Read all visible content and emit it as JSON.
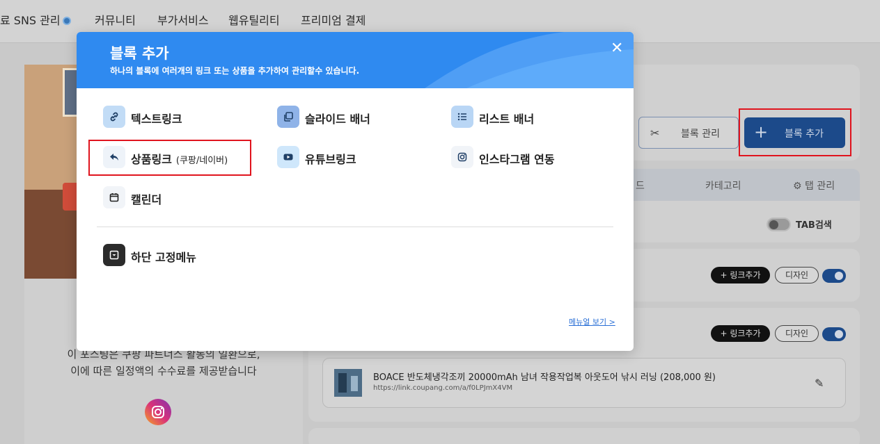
{
  "nav": {
    "items": [
      {
        "label": "료 SNS 관리",
        "badge": true
      },
      {
        "label": "커뮤니티"
      },
      {
        "label": "부가서비스"
      },
      {
        "label": "웹유틸리티"
      },
      {
        "label": "프리미엄 결제"
      }
    ]
  },
  "profile": {
    "notice_line1": "이 포스팅은 쿠팡 파트너스 활동의 일환으로,",
    "notice_line2": "이에 따른 일정액의 수수료를 제공받습니다"
  },
  "toolbar": {
    "block_manage_label": "블록 관리",
    "block_add_label": "블록 추가"
  },
  "tabs": {
    "partial_label": "드",
    "category_label": "카테고리",
    "tab_manage_label": "탭 관리",
    "tab_search_label": "TAB검색"
  },
  "blocks": [
    {
      "add_link_label": "+ 링크추가",
      "design_label": "디자인"
    },
    {
      "add_link_label": "+ 링크추가",
      "design_label": "디자인"
    }
  ],
  "product": {
    "title": "BOACE 반도체냉각조끼 20000mAh 남녀 작용작업복 아웃도어 낚시 러닝 (208,000 원)",
    "url": "https://link.coupang.com/a/f0LPJmX4VM"
  },
  "modal": {
    "title": "블록 추가",
    "subtitle": "하나의 블록에 여러개의 링크 또는 상품을 추가하여 관리할수 있습니다.",
    "items": [
      {
        "label": "텍스트링크",
        "icon": "link-icon"
      },
      {
        "label": "슬라이드 배너",
        "icon": "copy-icon"
      },
      {
        "label": "리스트 배너",
        "icon": "list-icon"
      },
      {
        "label": "상품링크",
        "sublabel": "(쿠팡/네이버)",
        "icon": "share-icon"
      },
      {
        "label": "유튜브링크",
        "icon": "youtube-icon"
      },
      {
        "label": "인스타그램 연동",
        "icon": "instagram-icon"
      },
      {
        "label": "캘린더",
        "icon": "calendar-icon"
      },
      {
        "label": "하단 고정메뉴",
        "icon": "fixed-menu-icon"
      }
    ],
    "manual_link": "메뉴얼 보기 >"
  },
  "colors": {
    "header_blue": "#2f8af0",
    "primary_navy": "#1c4a8a",
    "highlight_red": "#e0141e"
  }
}
